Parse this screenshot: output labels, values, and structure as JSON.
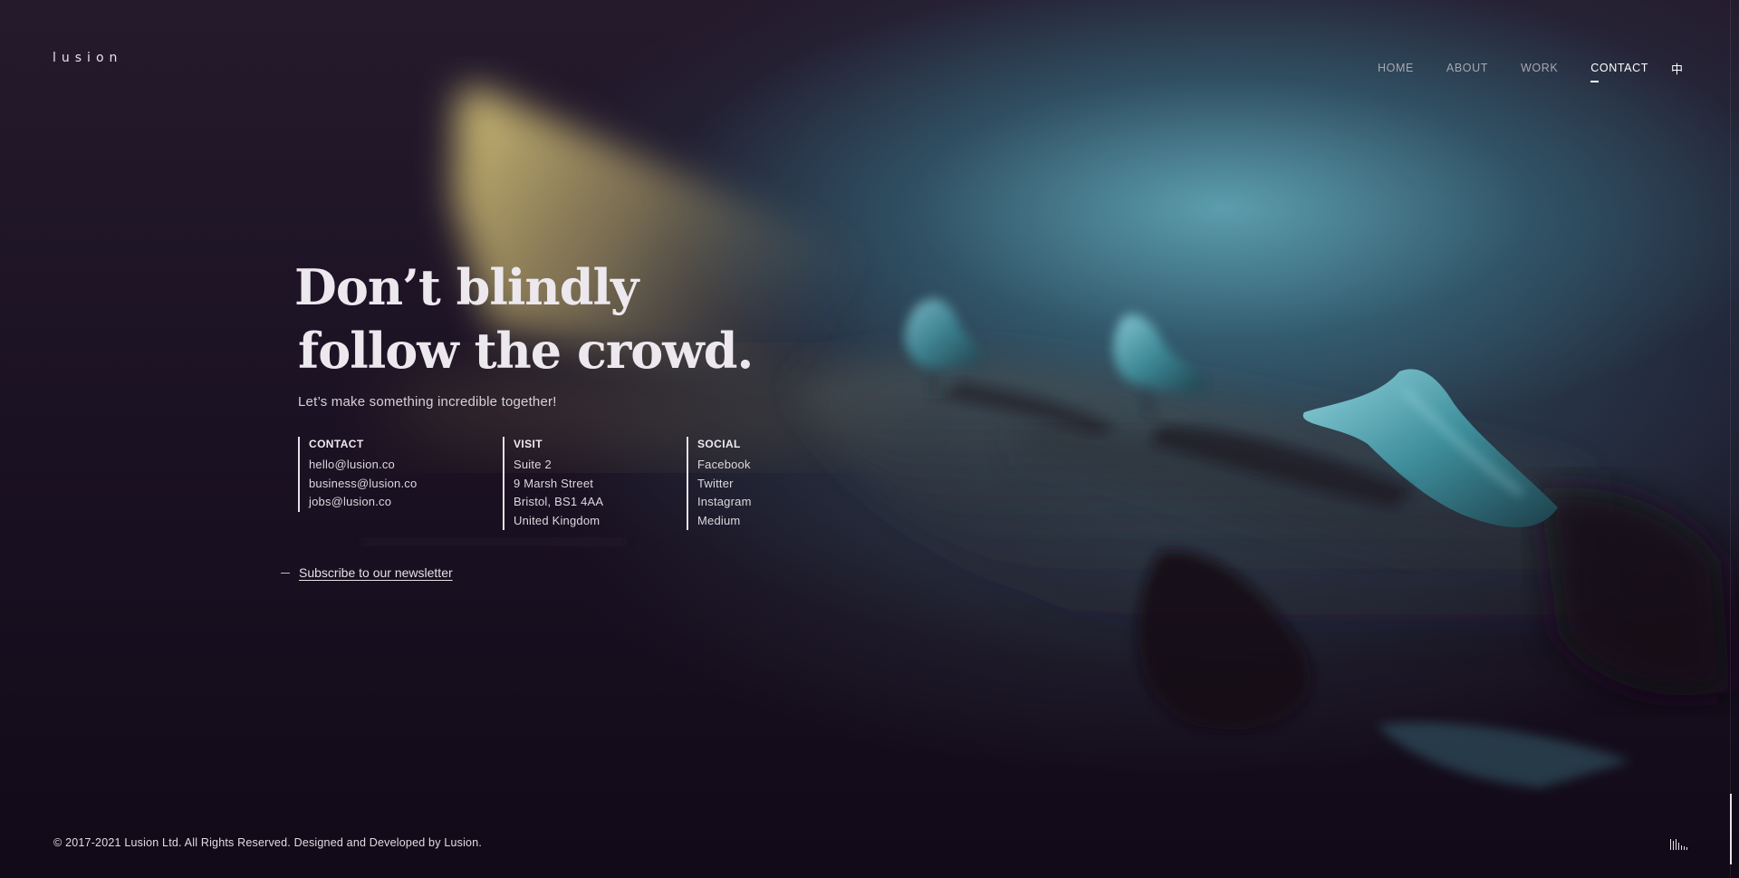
{
  "brand": {
    "logo": "lusion"
  },
  "nav": {
    "items": [
      {
        "label": "HOME"
      },
      {
        "label": "ABOUT"
      },
      {
        "label": "WORK"
      },
      {
        "label": "CONTACT"
      }
    ],
    "active": "CONTACT",
    "language_toggle": "中"
  },
  "hero": {
    "headline_line1": "Don’t blindly",
    "headline_line2": "follow the crowd.",
    "tagline": "Let’s make something incredible together!"
  },
  "contact": {
    "heading": "CONTACT",
    "items": [
      "hello@lusion.co",
      "business@lusion.co",
      "jobs@lusion.co"
    ]
  },
  "visit": {
    "heading": "VISIT",
    "lines": [
      "Suite 2",
      "9 Marsh Street",
      "Bristol, BS1 4AA",
      "United Kingdom"
    ]
  },
  "social": {
    "heading": "SOCIAL",
    "items": [
      "Facebook",
      "Twitter",
      "Instagram",
      "Medium"
    ]
  },
  "newsletter": {
    "label": "Subscribe to our newsletter"
  },
  "footer": {
    "copyright": "© 2017-2021 Lusion Ltd. All Rights Reserved. Designed and Developed by Lusion."
  },
  "icons": {
    "sound": "sound-equalizer-icon"
  },
  "colors": {
    "background": "#150b1d",
    "text": "#e6e1e6",
    "spotlight": "#c9b66c",
    "fog": "#64afbe"
  }
}
